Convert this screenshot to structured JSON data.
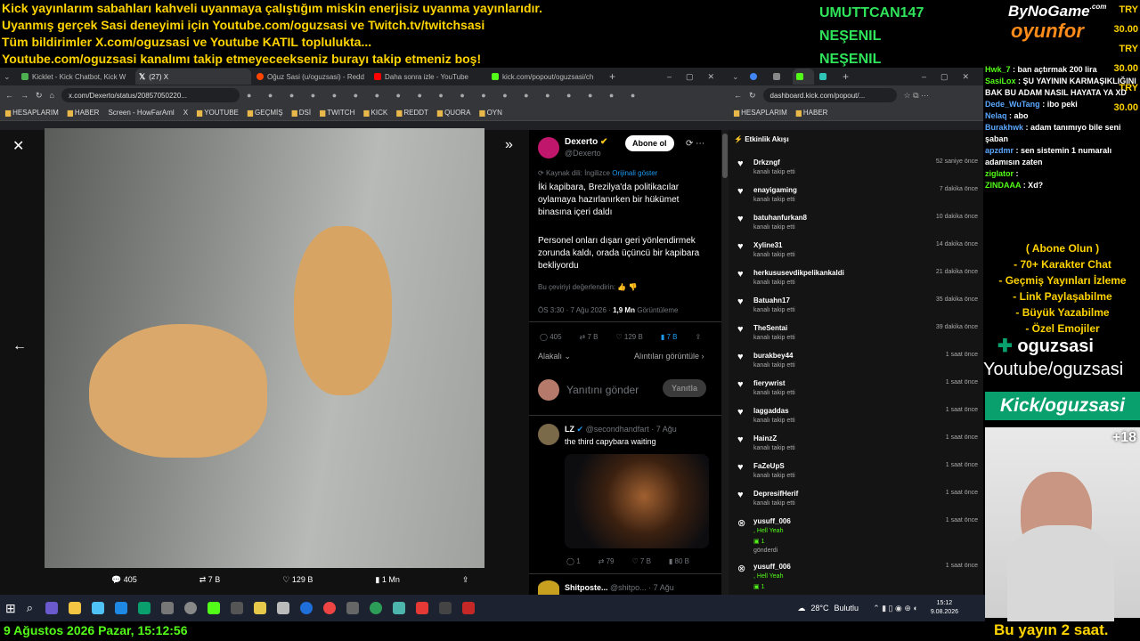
{
  "overlay": {
    "ticker": [
      "Kick yayınlarım sabahları kahveli uyanmaya çalıştığım miskin enerjisiz uyanma yayınlarıdır.",
      "Uyanmış gerçek Sasi deneyimi için Youtube.com/oguzsasi ve Twitch.tv/twitchsasi",
      "Tüm bildirimler X.com/oguzsasi ve Youtube KATIL toplulukta...",
      "Youtube.com/oguzsasi kanalımı takip etmeyeceekseniz burayı takip etmeniz boş!"
    ],
    "donors": [
      "UMUTTCAN147",
      "NEŞENIL",
      "NEŞENIL"
    ],
    "logo_top": "ByNoGame",
    "logo_com": ".com",
    "logo_bottom": "oyunfor",
    "tries": [
      "TRY 30.00",
      "TRY 30.00",
      "TRY 30.00"
    ],
    "promo": [
      "( Abone Olun )",
      "- 70+ Karakter Chat",
      "- Geçmiş Yayınları İzleme",
      "- Link Paylaşabilme",
      "- Büyük Yazabilme",
      "- Özel Emojiler"
    ],
    "brand_name": "oguzsasi",
    "brand_youtube": "Youtube/oguzsasi",
    "brand_kick": "Kick/oguzsasi",
    "cam_count": "+18",
    "date_line": "9 Ağustos 2026 Pazar, 15:12:56",
    "bottom_right": "Bu yayın 2 saat."
  },
  "left_browser": {
    "tabs": [
      "Kicklet - Kick Chatbot, Kick W",
      "(27) X",
      "Oğuz Sasi (u/oguzsasi) - Redd",
      "Daha sonra izle - YouTube",
      "kick.com/popout/oguzsasi/ch"
    ],
    "url": "x.com/Dexerto/status/20857050220...",
    "bookmarks": [
      "HESAPLARIM",
      "HABER",
      "Screen - HowFarAml",
      "X",
      "YOUTUBE",
      "GEÇMİŞ",
      "DSİ",
      "TWITCH",
      "KICK",
      "REDDT",
      "QUORA",
      "OYN"
    ],
    "video_stats": {
      "replies": "405",
      "reposts": "7 B",
      "likes": "129 B",
      "views": "1 Mn"
    }
  },
  "tweet": {
    "author": "Dexerto",
    "handle": "@Dexerto",
    "follow": "Abone ol",
    "source_lang": "Kaynak dili: İngilizce",
    "show_original": "Orijinali göster",
    "text1": "İki kapibara, Brezilya'da politikacılar oylamaya hazırlanırken bir hükümet binasına içeri daldı",
    "text2": "Personel onları dışarı geri yönlendirmek zorunda kaldı, orada üçüncü bir kapibara bekliyordu",
    "rate": "Bu çeviriyi değerlendirin:",
    "time": "ÖS 3:30 · 7 Ağu 2026 ·",
    "views": "1,9 Mn",
    "views_label": "Görüntüleme",
    "stats": {
      "replies": "405",
      "reposts": "7 B",
      "likes": "129 B",
      "bookmarks": "7 B"
    },
    "sort": "Alakalı",
    "quotes": "Alıntıları görüntüle",
    "reply_placeholder": "Yanıtını gönder",
    "reply_btn": "Yanıtla",
    "reply1": {
      "author": "LZ",
      "handle": "@secondhandfart · 7 Ağu",
      "text": "the third capybara waiting",
      "stats": [
        "1",
        "79",
        "7 B",
        "80 B"
      ]
    },
    "reply2": {
      "author": "Shitposte...",
      "handle": "@shitpo... · 7 Ağu"
    }
  },
  "right_browser": {
    "url": "dashboard.kick.com/popout/...",
    "bookmarks": [
      "HESAPLARIM",
      "HABER"
    ],
    "feed_title": "Etkinlik Akışı",
    "feed": [
      {
        "name": "Drkzngf",
        "sub": "kanalı takip etti",
        "time": "52 saniye önce"
      },
      {
        "name": "enayigaming",
        "sub": "kanalı takip etti",
        "time": "7 dakika önce"
      },
      {
        "name": "batuhanfurkan8",
        "sub": "kanalı takip etti",
        "time": "10 dakika önce"
      },
      {
        "name": "Xyline31",
        "sub": "kanalı takip etti",
        "time": "14 dakika önce"
      },
      {
        "name": "herkususevdikpelikankaldi",
        "sub": "kanalı takip etti",
        "time": "21 dakika önce"
      },
      {
        "name": "Batuahn17",
        "sub": "kanalı takip etti",
        "time": "35 dakika önce"
      },
      {
        "name": "TheSentai",
        "sub": "kanalı takip etti",
        "time": "39 dakika önce"
      },
      {
        "name": "burakbey44",
        "sub": "kanalı takip etti",
        "time": "1 saat önce"
      },
      {
        "name": "fierywrist",
        "sub": "kanalı takip etti",
        "time": "1 saat önce"
      },
      {
        "name": "laggaddas",
        "sub": "kanalı takip etti",
        "time": "1 saat önce"
      },
      {
        "name": "HainzZ",
        "sub": "kanalı takip etti",
        "time": "1 saat önce"
      },
      {
        "name": "FaZeUpS",
        "sub": "kanalı takip etti",
        "time": "1 saat önce"
      },
      {
        "name": "DepresifHerif",
        "sub": "kanalı takip etti",
        "time": "1 saat önce"
      }
    ],
    "gift1": {
      "name": "yusuff_006",
      "msg": ", Hell Yeah",
      "count": "1",
      "sub": "gönderdi",
      "time": "1 saat önce"
    },
    "gift2": {
      "name": "yusuff_006",
      "msg": ", Hell Yeah",
      "count": "1",
      "time": "1 saat önce"
    }
  },
  "chat": [
    {
      "user": "Hwk_7",
      "msg": ": ban açtırmak 200 lira",
      "c": "u"
    },
    {
      "user": "SasiLox",
      "msg": ": ŞU YAYININ KARMAŞIKLIĞINI BAK BU ADAM NASIL HAYATA YA XD",
      "c": "u"
    },
    {
      "user": "Dede_WuTang",
      "msg": ": ibo peki",
      "c": "u2"
    },
    {
      "user": "Nelaq",
      "msg": ": abo",
      "c": "u2"
    },
    {
      "user": "Burakhwk",
      "msg": ": adam tanımıyo bile seni şaban",
      "c": "u2"
    },
    {
      "user": "apzdmr",
      "msg": ": sen sistemin 1 numaralı adamısın zaten",
      "c": "u2"
    },
    {
      "user": "ziglator",
      "msg": ":",
      "c": "u"
    },
    {
      "user": "ZINDAAA",
      "msg": ": Xd?",
      "c": "u"
    }
  ],
  "taskbar": {
    "weather": "28°C",
    "weather_label": "Bulutlu",
    "time": "15:12",
    "date": "9.08.2026"
  },
  "colors": {
    "kick_green": "#53fc18",
    "ticker_yellow": "#ffd400",
    "x_blue": "#1d9bf0"
  }
}
